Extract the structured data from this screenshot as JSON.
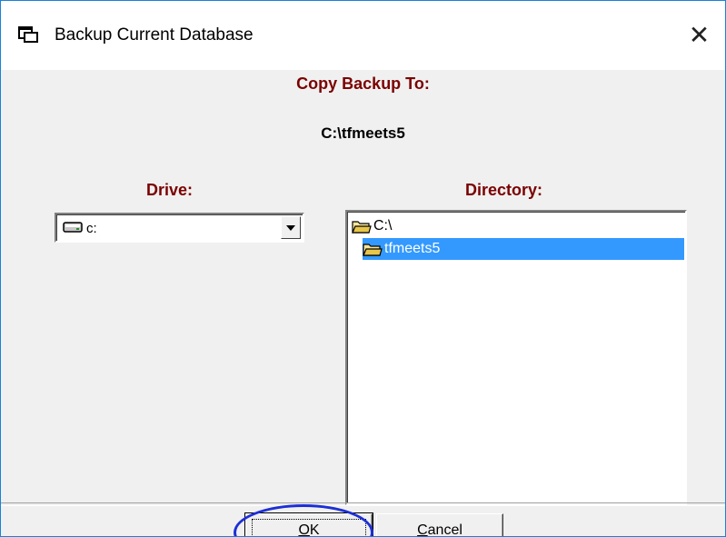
{
  "window": {
    "title": "Backup Current Database",
    "close_label": "✕"
  },
  "dialog": {
    "copy_backup_heading": "Copy Backup To:",
    "backup_path": "C:\\tfmeets5",
    "drive_label": "Drive:",
    "directory_label": "Directory:",
    "drive_selected": "c:",
    "directory_items": [
      {
        "label": "C:\\",
        "selected": false
      },
      {
        "label": "tfmeets5",
        "selected": true
      }
    ],
    "ok_label_mnemonic": "O",
    "ok_label_rest": "K",
    "cancel_label_mnemonic": "C",
    "cancel_label_rest": "ancel"
  },
  "colors": {
    "heading": "#7a0000",
    "selection": "#3399ff",
    "highlight_circle": "#1c2fd6"
  },
  "icons": {
    "title": "app-window-icon",
    "drive": "hard-drive-icon",
    "folder": "folder-icon",
    "dropdown": "chevron-down-icon"
  }
}
